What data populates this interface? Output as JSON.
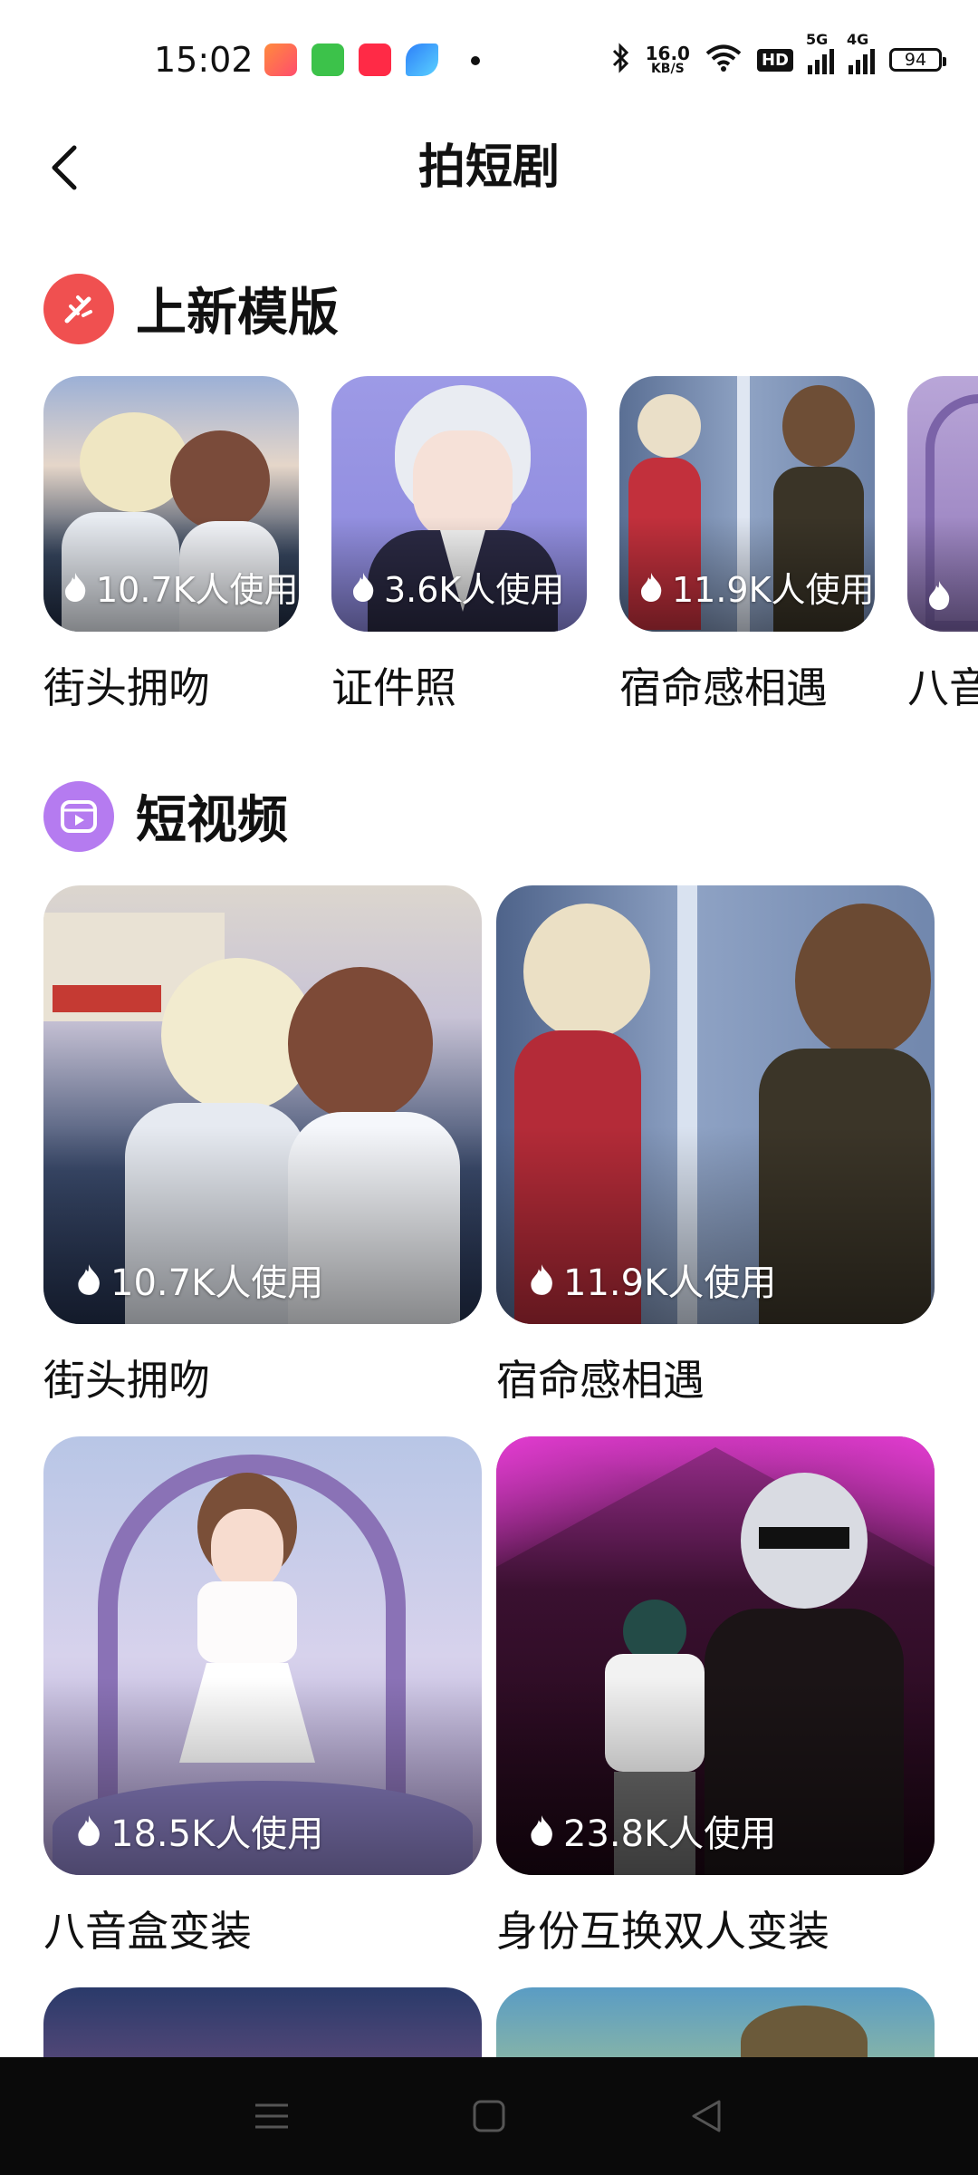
{
  "status_bar": {
    "time": "15:02",
    "net_speed_value": "16.0",
    "net_speed_unit": "KB/S",
    "hd_label": "HD",
    "sim1_label": "5G",
    "sim2_label": "4G",
    "battery": "94",
    "icons": [
      "bluetooth-icon",
      "wifi-icon",
      "signal-icon"
    ]
  },
  "header": {
    "title": "拍短剧",
    "back_icon": "chevron-left-icon"
  },
  "new_templates": {
    "title": "上新模版",
    "icon": "sparkle-icon",
    "accent": "#f05050",
    "items": [
      {
        "title": "街头拥吻",
        "usage": "10.7K人使用"
      },
      {
        "title": "证件照",
        "usage": "3.6K人使用"
      },
      {
        "title": "宿命感相遇",
        "usage": "11.9K人使用"
      },
      {
        "title": "八音",
        "usage": ""
      }
    ]
  },
  "short_videos": {
    "title": "短视频",
    "icon": "video-icon",
    "accent": "#b57bf0",
    "items": [
      {
        "title": "街头拥吻",
        "usage": "10.7K人使用"
      },
      {
        "title": "宿命感相遇",
        "usage": "11.9K人使用"
      },
      {
        "title": "八音盒变装",
        "usage": "18.5K人使用"
      },
      {
        "title": "身份互换双人变装",
        "usage": "23.8K人使用"
      }
    ]
  },
  "nav": {
    "icons": [
      "menu-icon",
      "home-square-icon",
      "back-triangle-icon"
    ]
  }
}
